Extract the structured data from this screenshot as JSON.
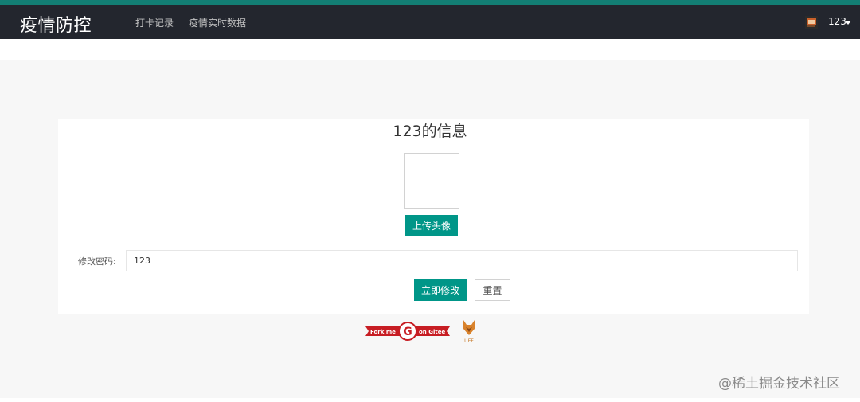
{
  "header": {
    "logo": "疫情防控",
    "nav": [
      {
        "label": "打卡记录"
      },
      {
        "label": "疫情实时数据"
      }
    ],
    "user": {
      "name": "123"
    }
  },
  "profile": {
    "title": "123的信息",
    "upload_label": "上传头像"
  },
  "form": {
    "password_label": "修改密码:",
    "password_value": "123",
    "submit_label": "立即修改",
    "reset_label": "重置"
  },
  "footer": {
    "badge_left": "Fork me",
    "badge_right": "on Gitee",
    "badge_letter": "G",
    "fox_text": "UEF"
  },
  "watermark": "@稀土掘金技术社区",
  "colors": {
    "header_bg": "#23262e",
    "accent": "#009688",
    "top_strip": "#137e74",
    "badge_red": "#c71d23"
  }
}
